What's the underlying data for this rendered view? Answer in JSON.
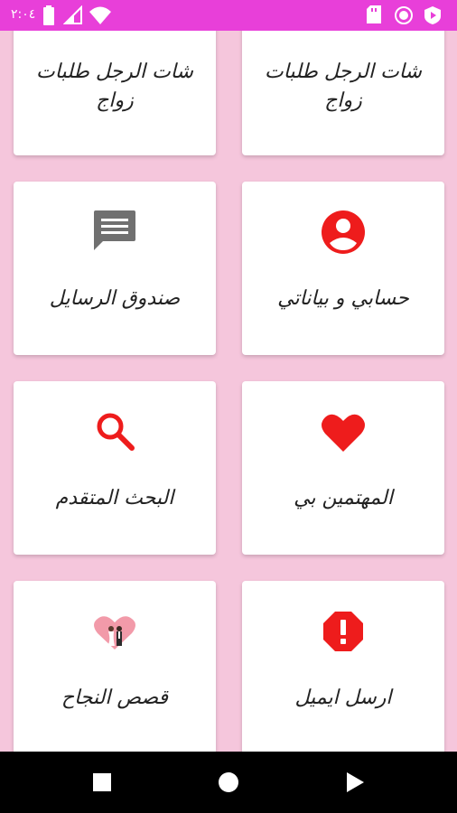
{
  "status_bar": {
    "time": "٢:٠٤",
    "bg_color": "#e83fd9"
  },
  "menu": {
    "cards": [
      {
        "label": "شات الرجل طلبات زواج",
        "icon": "none"
      },
      {
        "label": "شات الرجل طلبات زواج",
        "icon": "none"
      },
      {
        "label": "حسابي و بياناتي",
        "icon": "account-circle-icon",
        "icon_color": "#ee1c1c"
      },
      {
        "label": "صندوق الرسايل",
        "icon": "message-icon",
        "icon_color": "#707070"
      },
      {
        "label": "المهتمين بي",
        "icon": "heart-icon",
        "icon_color": "#ee1c1c"
      },
      {
        "label": "البحث المتقدم",
        "icon": "search-icon",
        "icon_color": "#ee1c1c"
      },
      {
        "label": "ارسل ايميل",
        "icon": "alert-octagon-icon",
        "icon_color": "#ee1c1c"
      },
      {
        "label": "قصص النجاح",
        "icon": "couple-heart-icon",
        "icon_color": "#f29aa9"
      }
    ]
  },
  "background_color": "#f5c6dc"
}
